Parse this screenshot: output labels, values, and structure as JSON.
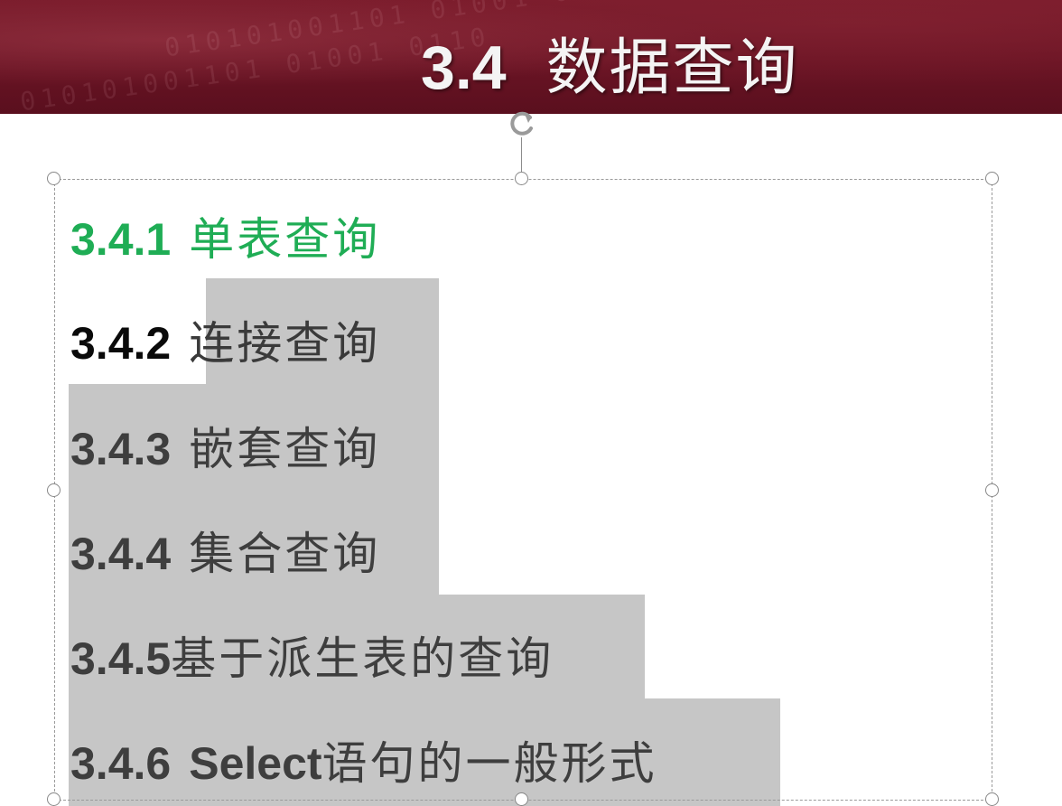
{
  "slide": {
    "title_number": "3.4",
    "title_text": "数据查询",
    "header_decoration": "010101001101 01001 0110"
  },
  "outline": {
    "items": [
      {
        "number": "3.4.1",
        "label": "单表查询",
        "state": "active",
        "color": "#1fad55"
      },
      {
        "number": "3.4.2",
        "label": "连接查询",
        "state": "partially-selected"
      },
      {
        "number": "3.4.3",
        "label": "嵌套查询",
        "state": "selected"
      },
      {
        "number": "3.4.4",
        "label": "集合查询",
        "state": "selected"
      },
      {
        "number": "3.4.5",
        "label": "基于派生表的查询",
        "state": "selected"
      },
      {
        "number": "3.4.6",
        "label_latin": "Select",
        "label": "语句的一般形式",
        "state": "selected"
      }
    ]
  },
  "colors": {
    "header_band": "#6a1424",
    "active_item": "#1fad55",
    "selection_highlight": "#c6c6c6",
    "title_text": "#f4f4f4"
  },
  "icons": {
    "rotate_handle": "rotate-icon",
    "resize_handle": "resize-handle-icon"
  }
}
